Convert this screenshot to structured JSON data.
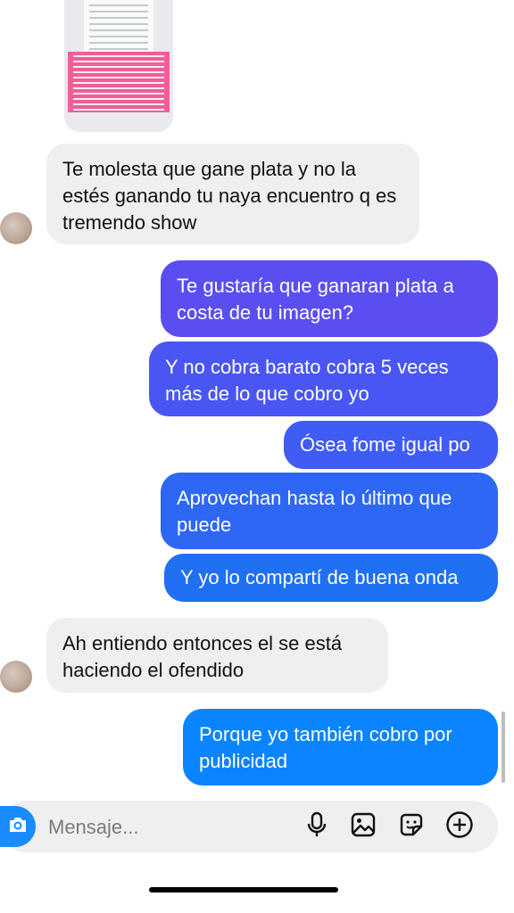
{
  "colors": {
    "incoming_bubble": "#efefef",
    "outgoing_gradient": [
      "#5b4ef0",
      "#3c5ff5",
      "#1f74f3",
      "#0a84ff"
    ],
    "accent": "#1a8cff"
  },
  "shared_image": {
    "icon": "image-thumbnail"
  },
  "messages": [
    {
      "id": "m1",
      "direction": "in",
      "text": "Te molesta que gane plata y no la estés ganando tu naya encuentro q es tremendo show"
    },
    {
      "id": "m2",
      "direction": "out",
      "text": "Te gustaría que ganaran plata a costa de tu imagen?"
    },
    {
      "id": "m3",
      "direction": "out",
      "text": "Y no cobra barato cobra 5 veces más de lo que cobro yo"
    },
    {
      "id": "m4",
      "direction": "out",
      "text": "Ósea fome igual po"
    },
    {
      "id": "m5",
      "direction": "out",
      "text": "Aprovechan hasta lo último que puede"
    },
    {
      "id": "m6",
      "direction": "out",
      "text": "Y yo lo compartí de buena onda"
    },
    {
      "id": "m7",
      "direction": "in",
      "text": "Ah entiendo entonces el se está haciendo el ofendido"
    },
    {
      "id": "m8",
      "direction": "out",
      "text": "Porque yo también cobro por publicidad"
    }
  ],
  "composer": {
    "placeholder": "Mensaje...",
    "icons": [
      "camera-icon",
      "microphone-icon",
      "gallery-icon",
      "sticker-icon",
      "plus-icon"
    ]
  }
}
